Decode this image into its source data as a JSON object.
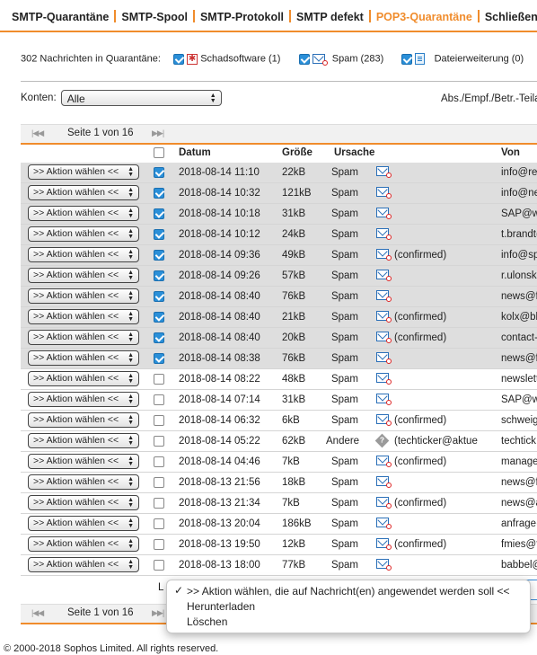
{
  "tabs": [
    {
      "label": "SMTP-Quarantäne",
      "active": false
    },
    {
      "label": "SMTP-Spool",
      "active": false
    },
    {
      "label": "SMTP-Protokoll",
      "active": false
    },
    {
      "label": "SMTP defekt",
      "active": false
    },
    {
      "label": "POP3-Quarantäne",
      "active": true
    },
    {
      "label": "Schließen",
      "active": false
    }
  ],
  "summary": {
    "count_text": "302 Nachrichten in Quarantäne:",
    "filter_malware": "Schadsoftware (1)",
    "filter_spam": "Spam (283)",
    "filter_ext": "Dateierweiterung (0)"
  },
  "accounts": {
    "label": "Konten:",
    "value": "Alle",
    "filter_label": "Abs./Empf./Betr.-Teila"
  },
  "pager": {
    "text": "Seite 1 von 16"
  },
  "columns": {
    "date": "Datum",
    "size": "Größe",
    "cause": "Ursache",
    "from": "Von"
  },
  "action_label": ">> Aktion wählen <<",
  "rows": [
    {
      "checked": true,
      "date": "2018-08-14 11:10",
      "size": "22kB",
      "cause": "Spam",
      "icon": "spam-mail-icon",
      "extra": "",
      "from": "info@rep"
    },
    {
      "checked": true,
      "date": "2018-08-14 10:32",
      "size": "121kB",
      "cause": "Spam",
      "icon": "spam-mail-icon",
      "extra": "",
      "from": "info@ne"
    },
    {
      "checked": true,
      "date": "2018-08-14 10:18",
      "size": "31kB",
      "cause": "Spam",
      "icon": "spam-mail-icon",
      "extra": "",
      "from": "SAP@w"
    },
    {
      "checked": true,
      "date": "2018-08-14 10:12",
      "size": "24kB",
      "cause": "Spam",
      "icon": "spam-mail-icon",
      "extra": "",
      "from": "t.brandt("
    },
    {
      "checked": true,
      "date": "2018-08-14 09:36",
      "size": "49kB",
      "cause": "Spam",
      "icon": "spam-mail-icon",
      "extra": "(confirmed)",
      "from": "info@sp"
    },
    {
      "checked": true,
      "date": "2018-08-14 09:26",
      "size": "57kB",
      "cause": "Spam",
      "icon": "spam-mail-icon",
      "extra": "",
      "from": "r.ulonsk"
    },
    {
      "checked": true,
      "date": "2018-08-14 08:40",
      "size": "76kB",
      "cause": "Spam",
      "icon": "spam-mail-icon",
      "extra": "",
      "from": "news@f"
    },
    {
      "checked": true,
      "date": "2018-08-14 08:40",
      "size": "21kB",
      "cause": "Spam",
      "icon": "spam-mail-icon",
      "extra": "(confirmed)",
      "from": "kolx@bh"
    },
    {
      "checked": true,
      "date": "2018-08-14 08:40",
      "size": "20kB",
      "cause": "Spam",
      "icon": "spam-mail-icon",
      "extra": "(confirmed)",
      "from": "contact-"
    },
    {
      "checked": true,
      "date": "2018-08-14 08:38",
      "size": "76kB",
      "cause": "Spam",
      "icon": "spam-mail-icon",
      "extra": "",
      "from": "news@f"
    },
    {
      "checked": false,
      "date": "2018-08-14 08:22",
      "size": "48kB",
      "cause": "Spam",
      "icon": "spam-mail-icon",
      "extra": "",
      "from": "newslett"
    },
    {
      "checked": false,
      "date": "2018-08-14 07:14",
      "size": "31kB",
      "cause": "Spam",
      "icon": "spam-mail-icon",
      "extra": "",
      "from": "SAP@w"
    },
    {
      "checked": false,
      "date": "2018-08-14 06:32",
      "size": "6kB",
      "cause": "Spam",
      "icon": "spam-mail-icon",
      "extra": "(confirmed)",
      "from": "schweig"
    },
    {
      "checked": false,
      "date": "2018-08-14 05:22",
      "size": "62kB",
      "cause": "Andere",
      "icon": "unknown-icon",
      "extra": "(techticker@aktue",
      "from": "techtick"
    },
    {
      "checked": false,
      "date": "2018-08-14 04:46",
      "size": "7kB",
      "cause": "Spam",
      "icon": "spam-mail-icon",
      "extra": "(confirmed)",
      "from": "manage"
    },
    {
      "checked": false,
      "date": "2018-08-13 21:56",
      "size": "18kB",
      "cause": "Spam",
      "icon": "spam-mail-icon",
      "extra": "",
      "from": "news@f"
    },
    {
      "checked": false,
      "date": "2018-08-13 21:34",
      "size": "7kB",
      "cause": "Spam",
      "icon": "spam-mail-icon",
      "extra": "(confirmed)",
      "from": "news@a"
    },
    {
      "checked": false,
      "date": "2018-08-13 20:04",
      "size": "186kB",
      "cause": "Spam",
      "icon": "spam-mail-icon",
      "extra": "",
      "from": "anfrage@"
    },
    {
      "checked": false,
      "date": "2018-08-13 19:50",
      "size": "12kB",
      "cause": "Spam",
      "icon": "spam-mail-icon",
      "extra": "(confirmed)",
      "from": "fmies@f"
    },
    {
      "checked": false,
      "date": "2018-08-13 18:00",
      "size": "77kB",
      "cause": "Spam",
      "icon": "spam-mail-icon",
      "extra": "",
      "from": "babbel@"
    }
  ],
  "bulk_dropdown": {
    "options": [
      ">> Aktion wählen, die auf Nachricht(en) angewendet werden soll <<",
      "Herunterladen",
      "Löschen"
    ],
    "selected": ">> Aktion wählen, die auf Nachricht(en) angewendet werden soll <<",
    "partial_label": "L"
  },
  "footer": "© 2000-2018 Sophos Limited. All rights reserved."
}
